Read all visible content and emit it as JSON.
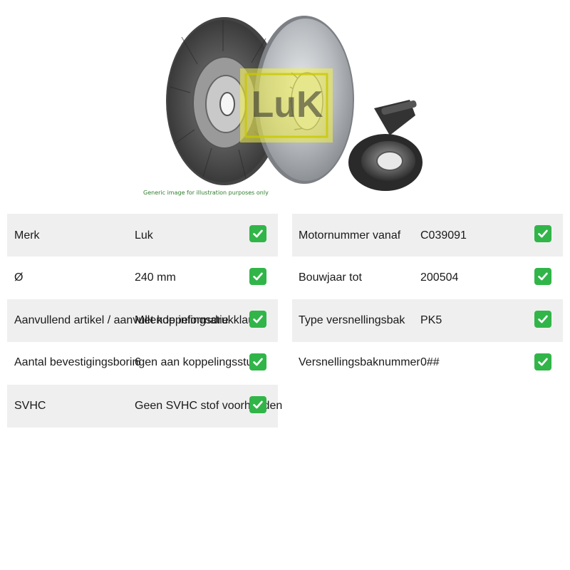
{
  "image": {
    "caption": "Generic image for illustration purposes only",
    "logo_text": "LuK"
  },
  "left_specs": [
    {
      "label": "Merk",
      "value": "Luk"
    },
    {
      "label": "Ø",
      "value": "240 mm"
    },
    {
      "label": "Aanvullend artikel / aanvullende informatie",
      "value": "Met koppelingsdrukklauw"
    },
    {
      "label": "Aantal bevestigingsboringen aan koppelingsstuk",
      "value": "6"
    },
    {
      "label": "SVHC",
      "value": "Geen SVHC stof voorhanden"
    }
  ],
  "right_specs": [
    {
      "label": "Motornummer vanaf",
      "value": "C039091"
    },
    {
      "label": "Bouwjaar tot",
      "value": "200504"
    },
    {
      "label": "Type versnellingsbak",
      "value": "PK5"
    },
    {
      "label": "Versnellingsbaknummer",
      "value": "0##"
    }
  ],
  "icons": {
    "check": "check-mark-button-icon"
  },
  "colors": {
    "check": "#31b549",
    "row_shade": "#efefef",
    "caption": "#2f7d2f"
  }
}
